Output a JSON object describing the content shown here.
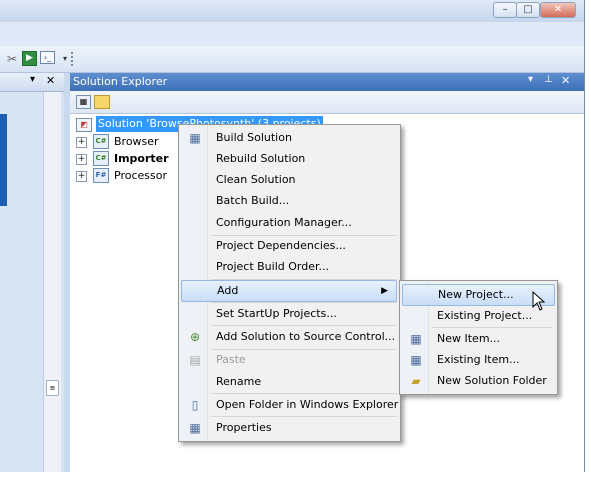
{
  "window": {
    "controls": {
      "minimize": "–",
      "maximize": "□",
      "close": "✕"
    }
  },
  "left_panel": {
    "pin": "▾",
    "close": "✕"
  },
  "solution_explorer": {
    "title": "Solution Explorer",
    "header_controls": {
      "dropdown": "▾",
      "pin": "⊥",
      "close": "✕"
    },
    "tree": {
      "root": "Solution 'BrowsePhotosynth' (3 projects)",
      "projects": [
        {
          "name": "Browser",
          "icon_text": "C#",
          "bold": false
        },
        {
          "name": "Importer",
          "icon_text": "C#",
          "bold": true
        },
        {
          "name": "Processor",
          "icon_text": "F#",
          "bold": false
        }
      ]
    }
  },
  "context_menu": {
    "items": [
      {
        "label": "Build Solution",
        "icon": "build-icon"
      },
      {
        "label": "Rebuild Solution"
      },
      {
        "label": "Clean Solution"
      },
      {
        "label": "Batch Build..."
      },
      {
        "label": "Configuration Manager..."
      },
      {
        "label": "Project Dependencies..."
      },
      {
        "label": "Project Build Order..."
      },
      {
        "label": "Add",
        "submenu": true,
        "highlighted": true
      },
      {
        "label": "Set StartUp Projects..."
      },
      {
        "label": "Add Solution to Source Control...",
        "icon": "source-control-icon"
      },
      {
        "label": "Paste",
        "disabled": true,
        "icon": "paste-icon"
      },
      {
        "label": "Rename"
      },
      {
        "label": "Open Folder in Windows Explorer",
        "icon": "open-folder-icon"
      },
      {
        "label": "Properties",
        "icon": "properties-icon"
      }
    ]
  },
  "add_submenu": {
    "items": [
      {
        "label": "New Project...",
        "highlighted": true
      },
      {
        "label": "Existing Project..."
      },
      {
        "label": "New Item...",
        "icon": "new-item-icon"
      },
      {
        "label": "Existing Item...",
        "icon": "existing-item-icon"
      },
      {
        "label": "New Solution Folder",
        "icon": "solution-folder-icon"
      }
    ]
  },
  "colors": {
    "accent_header": "#3d6fb8",
    "selection": "#3399ff",
    "menu_highlight": "#c9def8"
  }
}
